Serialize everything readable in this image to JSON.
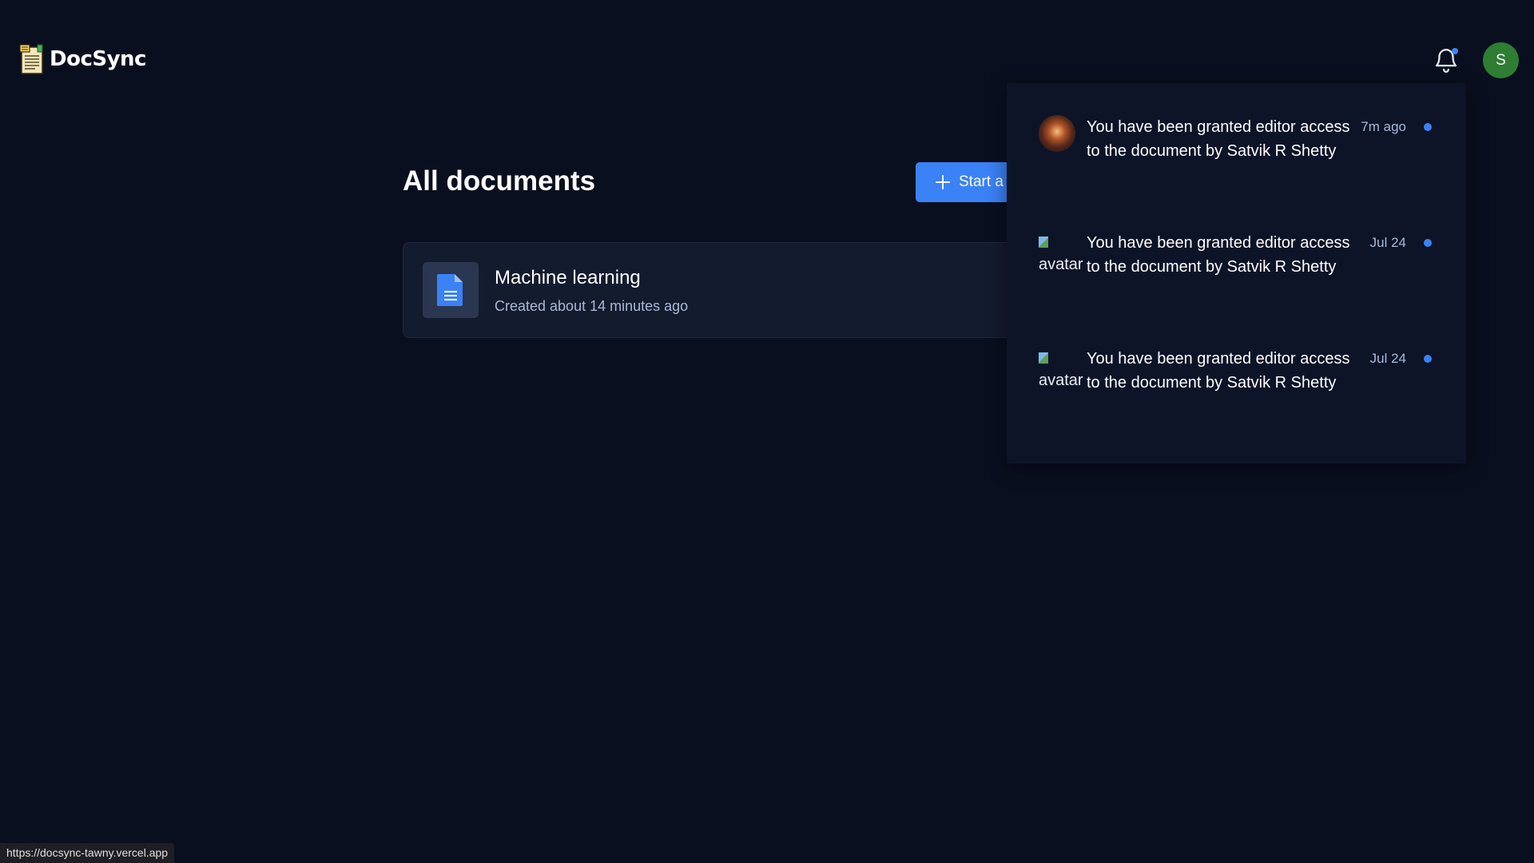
{
  "header": {
    "app_name": "DocSync",
    "user_initial": "S"
  },
  "main": {
    "title": "All documents",
    "start_button_label": "Start a",
    "documents": [
      {
        "title": "Machine learning",
        "meta": "Created about 14 minutes ago"
      }
    ]
  },
  "notifications": [
    {
      "avatar_alt": "",
      "text": "You have been granted editor access to the document by Satvik R Shetty",
      "time": "7m ago"
    },
    {
      "avatar_alt": "avatar",
      "text": "You have been granted editor access to the document by Satvik R Shetty",
      "time": "Jul 24"
    },
    {
      "avatar_alt": "avatar",
      "text": "You have been granted editor access to the document by Satvik R Shetty",
      "time": "Jul 24"
    }
  ],
  "status_bar": {
    "url": "https://docsync-tawny.vercel.app"
  },
  "colors": {
    "background": "#0a0f1f",
    "accent": "#3b82f6",
    "card": "#131b2e",
    "avatar": "#2e7d32"
  }
}
